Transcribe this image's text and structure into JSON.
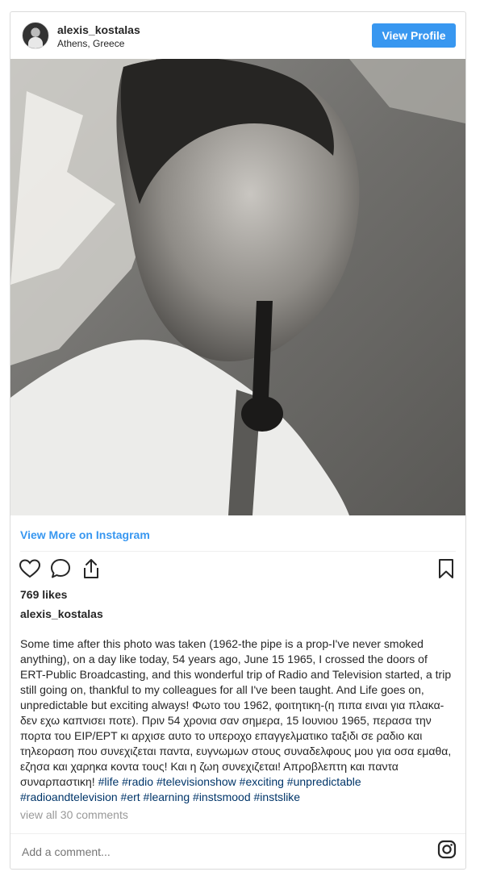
{
  "post": {
    "username": "alexis_kostalas",
    "location": "Athens, Greece",
    "view_profile": "View Profile",
    "view_more": "View More on Instagram",
    "likes": "769 likes",
    "caption_user": "alexis_kostalas",
    "caption_text": "Some time after this photo was taken (1962-the pipe is a prop-I've never smoked anything), on a day like today, 54 years ago, June 15 1965, I crossed the doors of ERT-Public Broadcasting, and this wonderful trip of Radio and Television started, a trip still going on, thankful to my colleagues for all I've been taught. And Life goes on, unpredictable but exciting always! Φωτο του 1962, φοιτητικη-(η πιπα ειναι για πλακα- δεν εχω καπνισει ποτε). Πριν 54 χρονια σαν σημερα, 15 Ιουνιου 1965, περασα την πορτα του ΕΙΡ/ΕΡΤ κι αρχισε αυτο το υπεροχο επαγγελματικο ταξιδι σε ραδιο και τηλεοραση που συνεχιζεται παντα, ευγνωμων στους συναδελφους μου για οσα εμαθα, εζησα και χαρηκα κοντα τους! Και η ζωη συνεχιζεται! Απροβλεπτη και παντα συναρπαστικη! ",
    "hashtags": "#life #radio #televisionshow #exciting #unpredictable #radioandtelevision #ert #learning #instsmood #instslike",
    "comments": "view all 30 comments",
    "comment_placeholder": "Add a comment..."
  },
  "icons": [
    "heart-icon",
    "comment-icon",
    "share-icon",
    "bookmark-icon",
    "instagram-icon"
  ],
  "colors": {
    "accent": "#3897f0",
    "hashtag": "#003569",
    "muted": "#999999"
  }
}
